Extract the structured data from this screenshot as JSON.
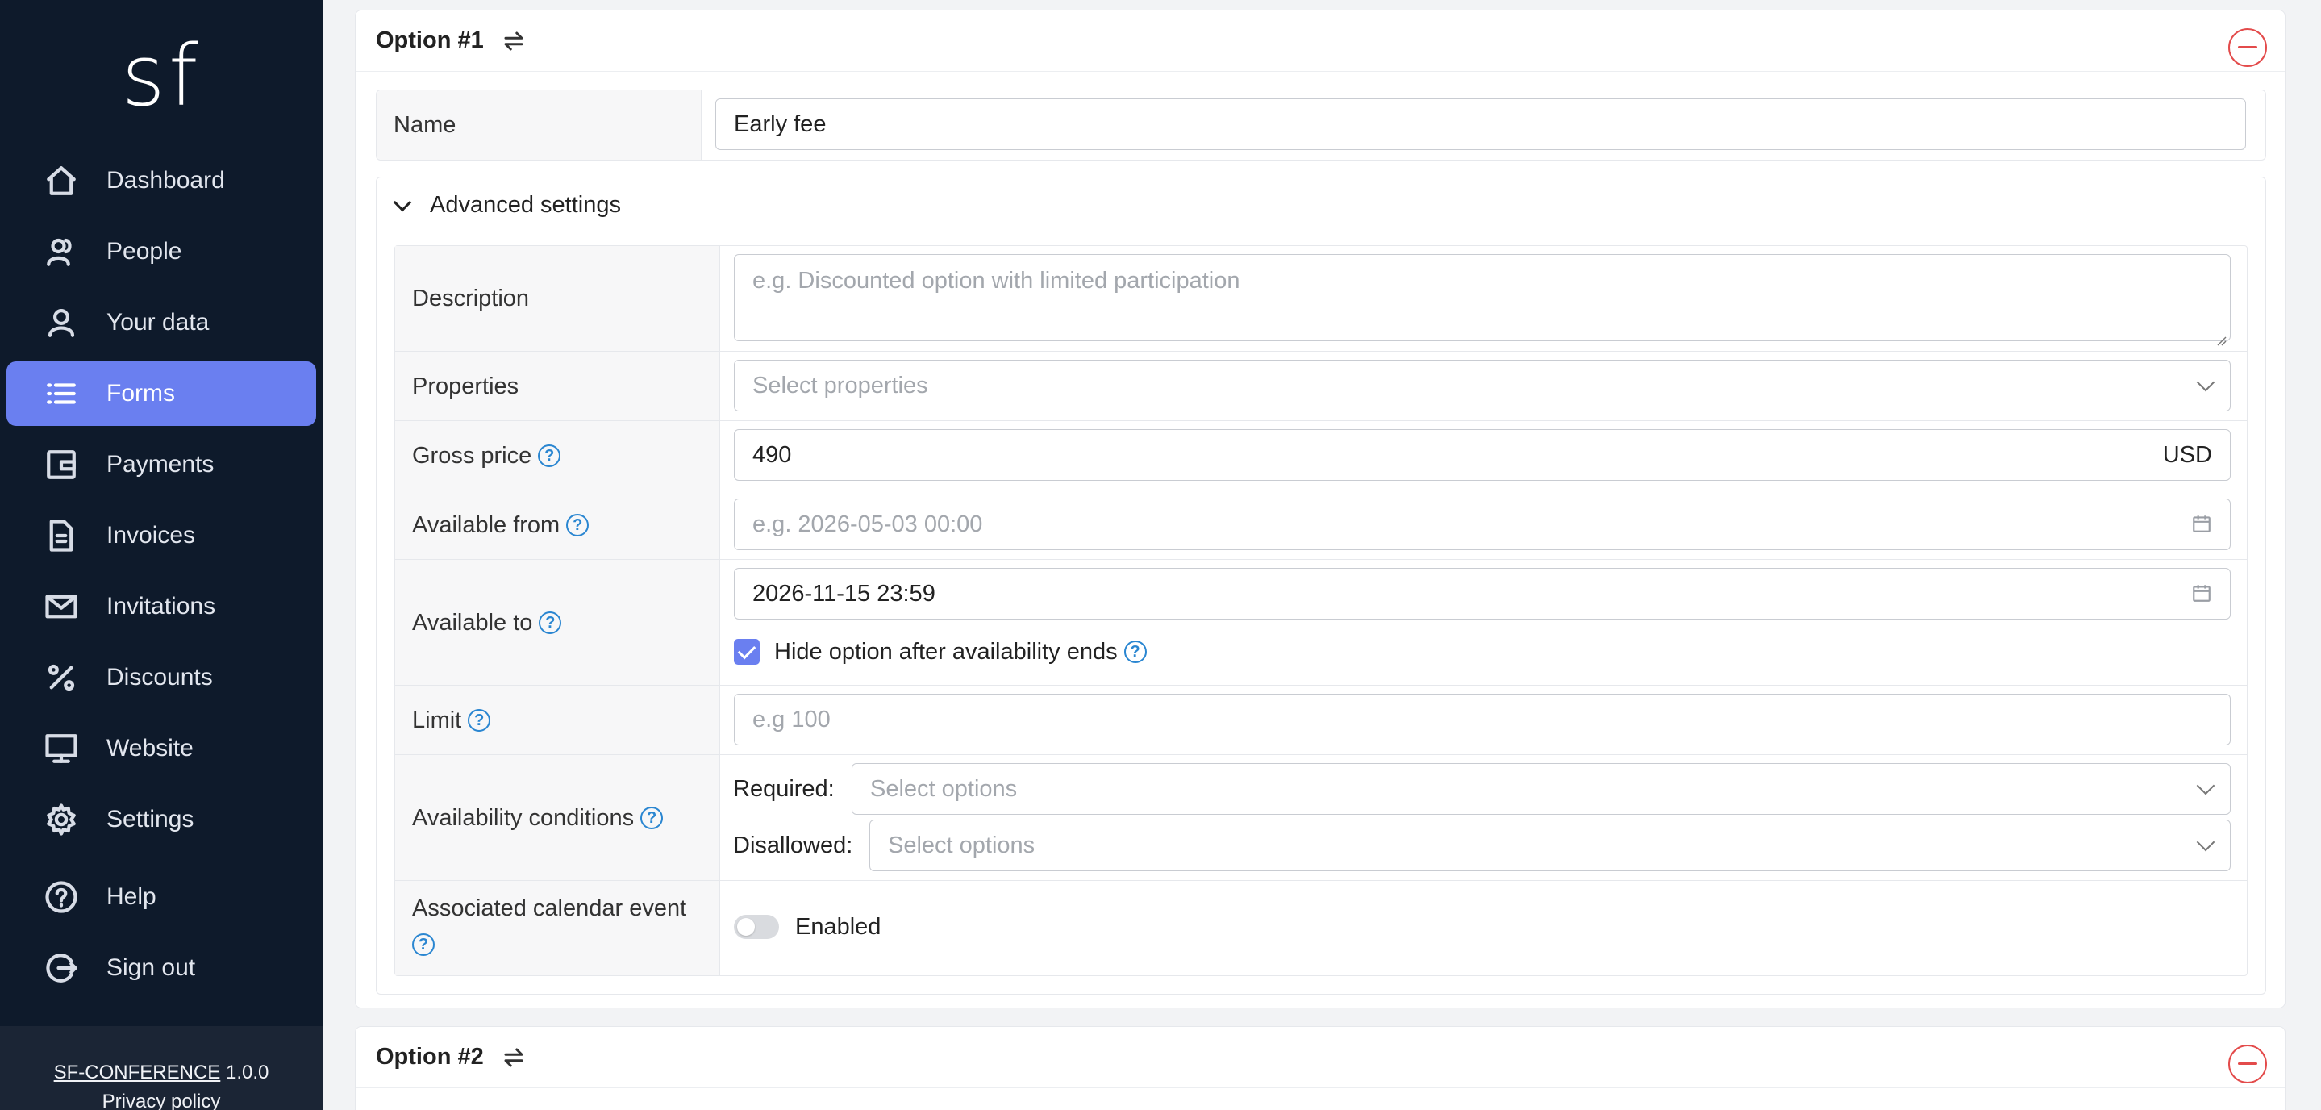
{
  "sidebar": {
    "logo": "sf",
    "items": [
      {
        "label": "Dashboard",
        "icon": "home-icon"
      },
      {
        "label": "People",
        "icon": "people-icon"
      },
      {
        "label": "Your data",
        "icon": "user-icon"
      },
      {
        "label": "Forms",
        "icon": "list-icon",
        "active": true
      },
      {
        "label": "Payments",
        "icon": "wallet-icon"
      },
      {
        "label": "Invoices",
        "icon": "document-icon"
      },
      {
        "label": "Invitations",
        "icon": "mail-icon"
      },
      {
        "label": "Discounts",
        "icon": "percent-icon"
      },
      {
        "label": "Website",
        "icon": "monitor-icon"
      },
      {
        "label": "Settings",
        "icon": "gear-icon"
      },
      {
        "label": "Help",
        "icon": "help-icon"
      },
      {
        "label": "Sign out",
        "icon": "sign-out-icon"
      }
    ],
    "footer": {
      "app_name": "SF-CONFERENCE",
      "version": "1.0.0",
      "privacy": "Privacy policy"
    }
  },
  "colors": {
    "accent": "#6a7ff0",
    "sidebar_bg": "#0e1a2b",
    "danger": "#e34b4b",
    "help": "#2a86d1"
  },
  "option1": {
    "title": "Option #1",
    "name_label": "Name",
    "name_value": "Early fee",
    "advanced_label": "Advanced settings",
    "description_label": "Description",
    "description_placeholder": "e.g. Discounted option with limited participation",
    "properties_label": "Properties",
    "properties_placeholder": "Select properties",
    "gross_price_label": "Gross price",
    "gross_price_value": "490",
    "currency": "USD",
    "available_from_label": "Available from",
    "available_from_placeholder": "e.g. 2026-05-03 00:00",
    "available_to_label": "Available to",
    "available_to_value": "2026-11-15 23:59",
    "hide_option_label": "Hide option after availability ends",
    "hide_option_checked": true,
    "limit_label": "Limit",
    "limit_placeholder": "e.g 100",
    "conditions_label": "Availability conditions",
    "required_label": "Required:",
    "required_placeholder": "Select options",
    "disallowed_label": "Disallowed:",
    "disallowed_placeholder": "Select options",
    "calendar_label": "Associated calendar event",
    "calendar_toggle_label": "Enabled",
    "calendar_enabled": false
  },
  "option2": {
    "title": "Option #2"
  }
}
